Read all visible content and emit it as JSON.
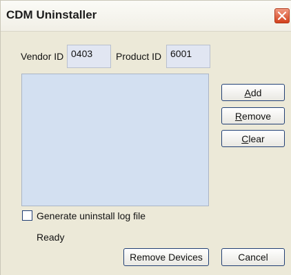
{
  "window": {
    "title": "CDM Uninstaller"
  },
  "ids": {
    "vendor_label": "Vendor ID",
    "vendor_value": "0403",
    "product_label": "Product ID",
    "product_value": "6001"
  },
  "side_buttons": {
    "add": {
      "mnemonic": "A",
      "rest": "dd"
    },
    "remove": {
      "mnemonic": "R",
      "rest": "emove"
    },
    "clear": {
      "mnemonic": "C",
      "rest": "lear"
    }
  },
  "checkbox": {
    "label": "Generate uninstall log file",
    "checked": false
  },
  "status_text": "Ready",
  "footer": {
    "remove_devices_label": "Remove Devices",
    "cancel_label": "Cancel"
  },
  "icons": {
    "close": "close-icon"
  },
  "colors": {
    "close_button": "#d2401c",
    "list_background": "#d3e0f1",
    "button_border": "#1f3d73"
  }
}
